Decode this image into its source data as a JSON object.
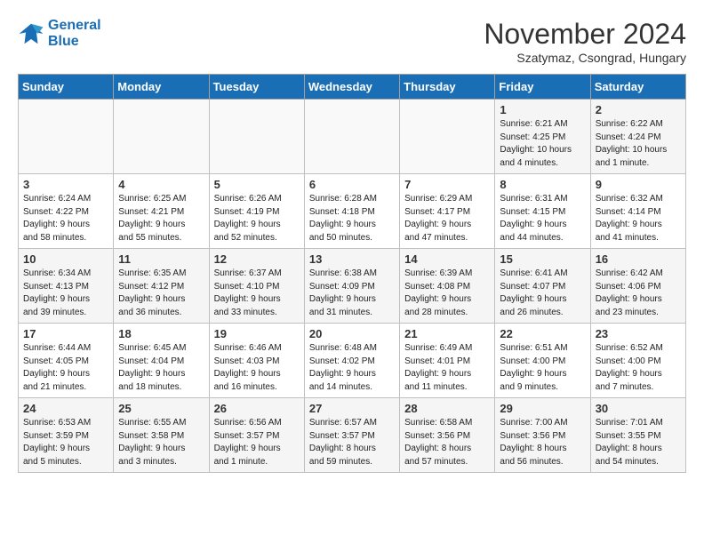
{
  "logo": {
    "line1": "General",
    "line2": "Blue"
  },
  "title": "November 2024",
  "subtitle": "Szatymaz, Csongrad, Hungary",
  "days_of_week": [
    "Sunday",
    "Monday",
    "Tuesday",
    "Wednesday",
    "Thursday",
    "Friday",
    "Saturday"
  ],
  "weeks": [
    [
      {
        "day": "",
        "info": ""
      },
      {
        "day": "",
        "info": ""
      },
      {
        "day": "",
        "info": ""
      },
      {
        "day": "",
        "info": ""
      },
      {
        "day": "",
        "info": ""
      },
      {
        "day": "1",
        "info": "Sunrise: 6:21 AM\nSunset: 4:25 PM\nDaylight: 10 hours\nand 4 minutes."
      },
      {
        "day": "2",
        "info": "Sunrise: 6:22 AM\nSunset: 4:24 PM\nDaylight: 10 hours\nand 1 minute."
      }
    ],
    [
      {
        "day": "3",
        "info": "Sunrise: 6:24 AM\nSunset: 4:22 PM\nDaylight: 9 hours\nand 58 minutes."
      },
      {
        "day": "4",
        "info": "Sunrise: 6:25 AM\nSunset: 4:21 PM\nDaylight: 9 hours\nand 55 minutes."
      },
      {
        "day": "5",
        "info": "Sunrise: 6:26 AM\nSunset: 4:19 PM\nDaylight: 9 hours\nand 52 minutes."
      },
      {
        "day": "6",
        "info": "Sunrise: 6:28 AM\nSunset: 4:18 PM\nDaylight: 9 hours\nand 50 minutes."
      },
      {
        "day": "7",
        "info": "Sunrise: 6:29 AM\nSunset: 4:17 PM\nDaylight: 9 hours\nand 47 minutes."
      },
      {
        "day": "8",
        "info": "Sunrise: 6:31 AM\nSunset: 4:15 PM\nDaylight: 9 hours\nand 44 minutes."
      },
      {
        "day": "9",
        "info": "Sunrise: 6:32 AM\nSunset: 4:14 PM\nDaylight: 9 hours\nand 41 minutes."
      }
    ],
    [
      {
        "day": "10",
        "info": "Sunrise: 6:34 AM\nSunset: 4:13 PM\nDaylight: 9 hours\nand 39 minutes."
      },
      {
        "day": "11",
        "info": "Sunrise: 6:35 AM\nSunset: 4:12 PM\nDaylight: 9 hours\nand 36 minutes."
      },
      {
        "day": "12",
        "info": "Sunrise: 6:37 AM\nSunset: 4:10 PM\nDaylight: 9 hours\nand 33 minutes."
      },
      {
        "day": "13",
        "info": "Sunrise: 6:38 AM\nSunset: 4:09 PM\nDaylight: 9 hours\nand 31 minutes."
      },
      {
        "day": "14",
        "info": "Sunrise: 6:39 AM\nSunset: 4:08 PM\nDaylight: 9 hours\nand 28 minutes."
      },
      {
        "day": "15",
        "info": "Sunrise: 6:41 AM\nSunset: 4:07 PM\nDaylight: 9 hours\nand 26 minutes."
      },
      {
        "day": "16",
        "info": "Sunrise: 6:42 AM\nSunset: 4:06 PM\nDaylight: 9 hours\nand 23 minutes."
      }
    ],
    [
      {
        "day": "17",
        "info": "Sunrise: 6:44 AM\nSunset: 4:05 PM\nDaylight: 9 hours\nand 21 minutes."
      },
      {
        "day": "18",
        "info": "Sunrise: 6:45 AM\nSunset: 4:04 PM\nDaylight: 9 hours\nand 18 minutes."
      },
      {
        "day": "19",
        "info": "Sunrise: 6:46 AM\nSunset: 4:03 PM\nDaylight: 9 hours\nand 16 minutes."
      },
      {
        "day": "20",
        "info": "Sunrise: 6:48 AM\nSunset: 4:02 PM\nDaylight: 9 hours\nand 14 minutes."
      },
      {
        "day": "21",
        "info": "Sunrise: 6:49 AM\nSunset: 4:01 PM\nDaylight: 9 hours\nand 11 minutes."
      },
      {
        "day": "22",
        "info": "Sunrise: 6:51 AM\nSunset: 4:00 PM\nDaylight: 9 hours\nand 9 minutes."
      },
      {
        "day": "23",
        "info": "Sunrise: 6:52 AM\nSunset: 4:00 PM\nDaylight: 9 hours\nand 7 minutes."
      }
    ],
    [
      {
        "day": "24",
        "info": "Sunrise: 6:53 AM\nSunset: 3:59 PM\nDaylight: 9 hours\nand 5 minutes."
      },
      {
        "day": "25",
        "info": "Sunrise: 6:55 AM\nSunset: 3:58 PM\nDaylight: 9 hours\nand 3 minutes."
      },
      {
        "day": "26",
        "info": "Sunrise: 6:56 AM\nSunset: 3:57 PM\nDaylight: 9 hours\nand 1 minute."
      },
      {
        "day": "27",
        "info": "Sunrise: 6:57 AM\nSunset: 3:57 PM\nDaylight: 8 hours\nand 59 minutes."
      },
      {
        "day": "28",
        "info": "Sunrise: 6:58 AM\nSunset: 3:56 PM\nDaylight: 8 hours\nand 57 minutes."
      },
      {
        "day": "29",
        "info": "Sunrise: 7:00 AM\nSunset: 3:56 PM\nDaylight: 8 hours\nand 56 minutes."
      },
      {
        "day": "30",
        "info": "Sunrise: 7:01 AM\nSunset: 3:55 PM\nDaylight: 8 hours\nand 54 minutes."
      }
    ]
  ]
}
